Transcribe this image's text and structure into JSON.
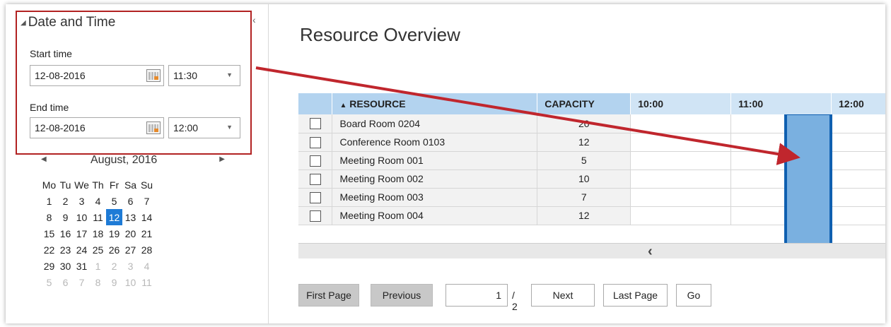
{
  "date_time_panel": {
    "header": "Date and Time",
    "start_label": "Start time",
    "start_date": "12-08-2016",
    "start_time": "11:30",
    "end_label": "End time",
    "end_date": "12-08-2016",
    "end_time": "12:00"
  },
  "calendar": {
    "month_title": "August, 2016",
    "weekdays": [
      "Mo",
      "Tu",
      "We",
      "Th",
      "Fr",
      "Sa",
      "Su"
    ],
    "days": [
      [
        "1",
        "2",
        "3",
        "4",
        "5",
        "6",
        "7"
      ],
      [
        "8",
        "9",
        "10",
        "11",
        "12",
        "13",
        "14"
      ],
      [
        "15",
        "16",
        "17",
        "18",
        "19",
        "20",
        "21"
      ],
      [
        "22",
        "23",
        "24",
        "25",
        "26",
        "27",
        "28"
      ],
      [
        "29",
        "30",
        "31",
        "1",
        "2",
        "3",
        "4"
      ],
      [
        "5",
        "6",
        "7",
        "8",
        "9",
        "10",
        "11"
      ]
    ],
    "selected_day": "12",
    "muted_from_index": 31
  },
  "main": {
    "title": "Resource Overview",
    "columns": {
      "resource": "RESOURCE",
      "capacity": "CAPACITY",
      "times": [
        "10:00",
        "11:00",
        "12:00"
      ]
    },
    "sort_icon": "sort-ascending-icon",
    "rows": [
      {
        "resource": "Board Room 0204",
        "capacity": "20"
      },
      {
        "resource": "Conference Room 0103",
        "capacity": "12"
      },
      {
        "resource": "Meeting Room 001",
        "capacity": "5"
      },
      {
        "resource": "Meeting Room 002",
        "capacity": "10"
      },
      {
        "resource": "Meeting Room 003",
        "capacity": "7"
      },
      {
        "resource": "Meeting Room 004",
        "capacity": "12"
      }
    ]
  },
  "pager": {
    "first": "First Page",
    "previous": "Previous",
    "current_page": "1",
    "total": "/ 2",
    "next": "Next",
    "last": "Last Page",
    "go": "Go"
  },
  "colors": {
    "highlight_border": "#b22222",
    "selected_day": "#1e7bd6",
    "booking_fill": "#7ab0e0",
    "header_fill": "#b3d3ef"
  }
}
